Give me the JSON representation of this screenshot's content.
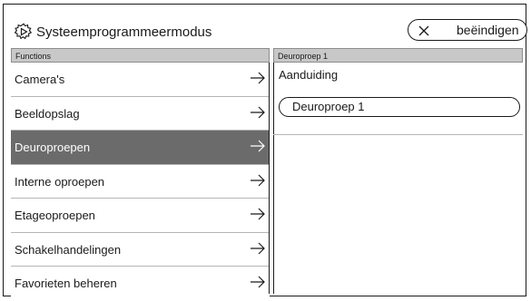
{
  "header": {
    "title": "Systeemprogrammeermodus",
    "end_button_label": "beëindigen",
    "settings_icon": "gear-icon",
    "close_icon": "close-icon"
  },
  "functions": {
    "heading": "Functions",
    "items": [
      {
        "label": "Camera's"
      },
      {
        "label": "Beeldopslag"
      },
      {
        "label": "Deuroproepen"
      },
      {
        "label": "Interne oproepen"
      },
      {
        "label": "Etageoproepen"
      },
      {
        "label": "Schakelhandelingen"
      },
      {
        "label": "Favorieten beheren"
      }
    ],
    "selected": "Deuroproepen",
    "arrow_icon": "arrow-right-icon"
  },
  "detail": {
    "heading": "Deuroproep 1",
    "field_label": "Aanduiding",
    "field_value": "Deuroproep 1"
  },
  "colors": {
    "selected_bg": "#6b6b6b",
    "header_bar": "#c8c8c8"
  }
}
